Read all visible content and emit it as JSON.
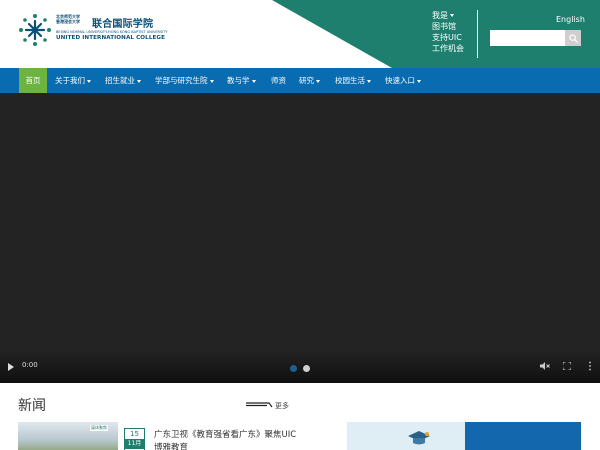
{
  "header": {
    "logo": {
      "cn_small_1": "北京师范大学",
      "cn_small_2": "香港浸会大学",
      "cn_big": "联合国际学院",
      "en_small": "BEIJING NORMAL UNIVERSITY-HONG KONG BAPTIST UNIVERSITY",
      "en_big": "UNITED INTERNATIONAL COLLEGE",
      "colors": {
        "primary": "#0a4f77",
        "accent": "#1f7f6f"
      }
    },
    "quick_links": [
      "我是",
      "图书馆",
      "支持UIC",
      "工作机会"
    ],
    "language": "English",
    "search": {
      "placeholder": "",
      "icon": "search-icon"
    },
    "band_color": "#1f7f6f"
  },
  "nav": {
    "color": "#0a6cb0",
    "active_color": "#6cb33f",
    "items": [
      {
        "label": "首页",
        "active": true,
        "has_dropdown": false
      },
      {
        "label": "关于我们",
        "has_dropdown": true
      },
      {
        "label": "招生就业",
        "has_dropdown": true
      },
      {
        "label": "学部与研究生院",
        "has_dropdown": true
      },
      {
        "label": "教与学",
        "has_dropdown": true
      },
      {
        "label": "师资",
        "has_dropdown": false
      },
      {
        "label": "研究",
        "has_dropdown": true
      },
      {
        "label": "校园生活",
        "has_dropdown": true
      },
      {
        "label": "快速入口",
        "has_dropdown": true
      }
    ]
  },
  "video": {
    "time": "0:00",
    "icons": [
      "play-icon",
      "mute-icon",
      "fullscreen-icon",
      "menu-icon"
    ],
    "slides": {
      "count": 2,
      "active": 1
    }
  },
  "news": {
    "title": "新闻",
    "more_label": "更多",
    "featured": {
      "thumb_label": "媒体聚焦",
      "day": "15",
      "month": "11月",
      "headline": "广东卫视《教育强省看广东》聚焦UIC博雅教育"
    }
  }
}
